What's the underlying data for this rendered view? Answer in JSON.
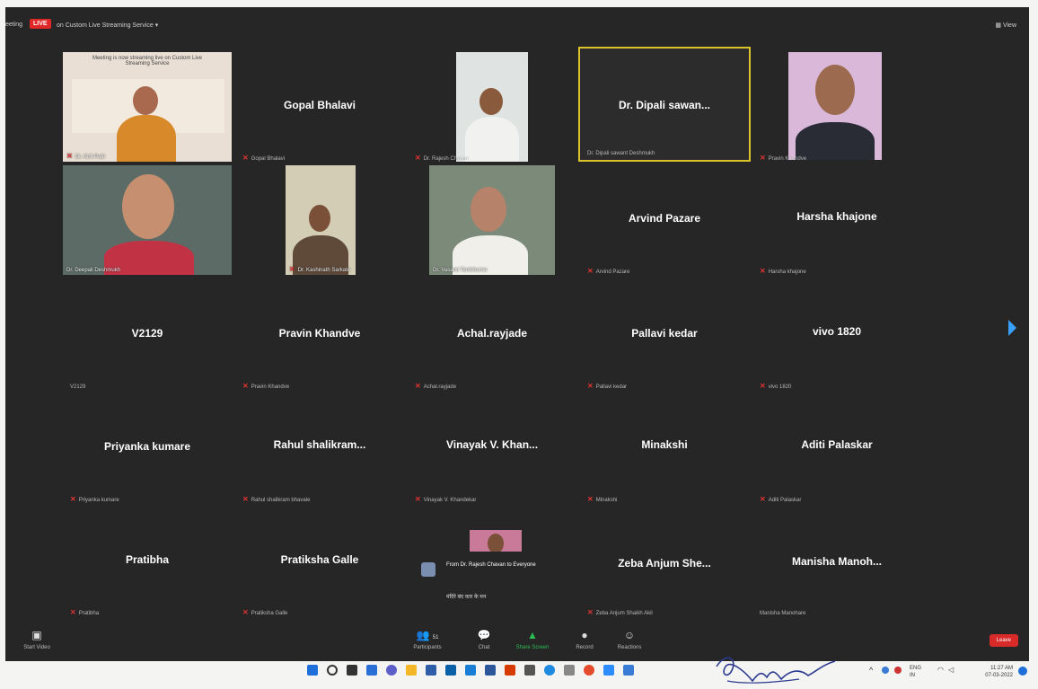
{
  "topbar": {
    "meeting_label": "eeting",
    "live_badge": "LIVE",
    "stream_label": "on Custom Live Streaming Service ▾",
    "view_label": "▦ View"
  },
  "stream_notice": "Meeting is now streaming live on Custom Live Streaming Service",
  "tiles": [
    {
      "name": "",
      "label": "Dr. Kirti Patil"
    },
    {
      "name": "Gopal Bhalavi",
      "label": "Gopal Bhalavi"
    },
    {
      "name": "",
      "label": "Dr. Rajesh Chavan"
    },
    {
      "name": "Dr. Dipali sawan...",
      "label": "Dr. Dipali sawant Deshmukh"
    },
    {
      "name": "",
      "label": "Pravin Khandve"
    },
    {
      "name": "",
      "label": "Dr. Deepali Deshmukh"
    },
    {
      "name": "",
      "label": "Dr. Kashinath Sarkate"
    },
    {
      "name": "",
      "label": "Dr. Vasanti Tembhurne"
    },
    {
      "name": "Arvind Pazare",
      "label": "Arvind Pazare"
    },
    {
      "name": "Harsha khajone",
      "label": "Harsha khajone"
    },
    {
      "name": "V2129",
      "label": "V2129"
    },
    {
      "name": "Pravin Khandve",
      "label": "Pravin Khandve"
    },
    {
      "name": "Achal.rayjade",
      "label": "Achal.rayjade"
    },
    {
      "name": "Pallavi kedar",
      "label": "Pallavi kedar"
    },
    {
      "name": "vivo 1820",
      "label": "vivo 1820"
    },
    {
      "name": "Priyanka kumare",
      "label": "Priyanka kumare"
    },
    {
      "name": "Rahul  shalikram...",
      "label": "Rahul shalikram bhavale"
    },
    {
      "name": "Vinayak V. Khan...",
      "label": "Vinayak V. Khandekar"
    },
    {
      "name": "Minakshi",
      "label": "Minakshi"
    },
    {
      "name": "Aditi Palaskar",
      "label": "Aditi Palaskar"
    },
    {
      "name": "Pratibha",
      "label": "Pratibha"
    },
    {
      "name": "Pratiksha Galle",
      "label": "Pratiksha Galle"
    },
    {
      "name": "",
      "label": ""
    },
    {
      "name": "Zeba Anjum She...",
      "label": "Zeba Anjum Shaikh Akil"
    },
    {
      "name": "Manisha  Manoh...",
      "label": "Manisha Manohare"
    }
  ],
  "chat": {
    "from": "From Dr. Rajesh Chavan to Everyone",
    "message": "मंदिरे बंद कार के मन"
  },
  "toolbar": {
    "start_video": "Start Video",
    "participants": "Participants",
    "participants_count": "51",
    "chat": "Chat",
    "share_screen": "Share Screen",
    "record": "Record",
    "reactions": "Reactions",
    "leave": "Leave"
  },
  "taskbar": {
    "lang_top": "ENG",
    "lang_bottom": "IN",
    "time": "11:27 AM",
    "date": "07-03-2022"
  },
  "colors": {
    "meeting_bg": "#262626",
    "live_red": "#e02828",
    "active_speaker_border": "#d9c22b",
    "leave_red": "#d92a2a"
  }
}
